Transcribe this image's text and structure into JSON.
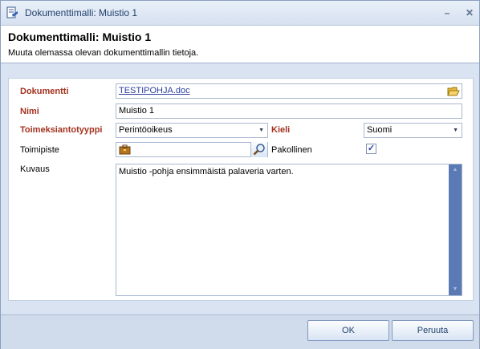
{
  "window": {
    "title": "Dokumenttimalli: Muistio 1"
  },
  "header": {
    "title": "Dokumenttimalli: Muistio 1",
    "subtitle": "Muuta olemassa olevan dokumenttimallin tietoja."
  },
  "form": {
    "dokumentti": {
      "label": "Dokumentti",
      "value": "TESTIPOHJA.doc"
    },
    "nimi": {
      "label": "Nimi",
      "value": "Muistio 1"
    },
    "toimeksiantotyyppi": {
      "label": "Toimeksiantotyyppi",
      "value": "Perintöoikeus"
    },
    "kieli": {
      "label": "Kieli",
      "value": "Suomi"
    },
    "toimipiste": {
      "label": "Toimipiste",
      "value": ""
    },
    "pakollinen": {
      "label": "Pakollinen",
      "checked": true,
      "mark": "✓"
    },
    "kuvaus": {
      "label": "Kuvaus",
      "value": "Muistio -pohja ensimmäistä palaveria varten."
    }
  },
  "buttons": {
    "ok": "OK",
    "cancel": "Peruuta"
  },
  "colors": {
    "required_label": "#a4321f",
    "link": "#2b3f9e",
    "scrollbar": "#5a7ab5"
  }
}
